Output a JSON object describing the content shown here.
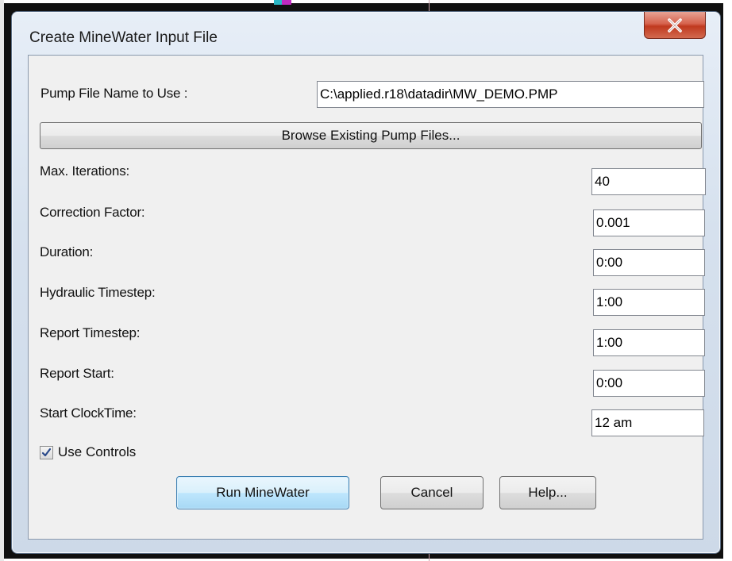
{
  "dialog": {
    "title": "Create MineWater Input File",
    "close_icon": "close-x-icon"
  },
  "pump_file": {
    "label": "Pump File Name to Use :",
    "value": "C:\\applied.r18\\datadir\\MW_DEMO.PMP"
  },
  "browse_button": "Browse Existing Pump Files...",
  "fields": [
    {
      "label": "Max. Iterations:",
      "value": "40"
    },
    {
      "label": "Correction Factor:",
      "value": "0.001"
    },
    {
      "label": "Duration:",
      "value": "0:00"
    },
    {
      "label": "Hydraulic Timestep:",
      "value": "1:00"
    },
    {
      "label": "Report Timestep:",
      "value": "1:00"
    },
    {
      "label": "Report Start:",
      "value": "0:00"
    },
    {
      "label": "Start ClockTime:",
      "value": "12 am"
    }
  ],
  "use_controls": {
    "label": "Use Controls",
    "checked": true,
    "icon": "checkmark-icon"
  },
  "buttons": {
    "run": "Run MineWater",
    "cancel": "Cancel",
    "help": "Help..."
  },
  "colors": {
    "close_button": "#c7432a",
    "default_button_border": "#3c7fb1",
    "client_bg": "#f0f0f0"
  }
}
